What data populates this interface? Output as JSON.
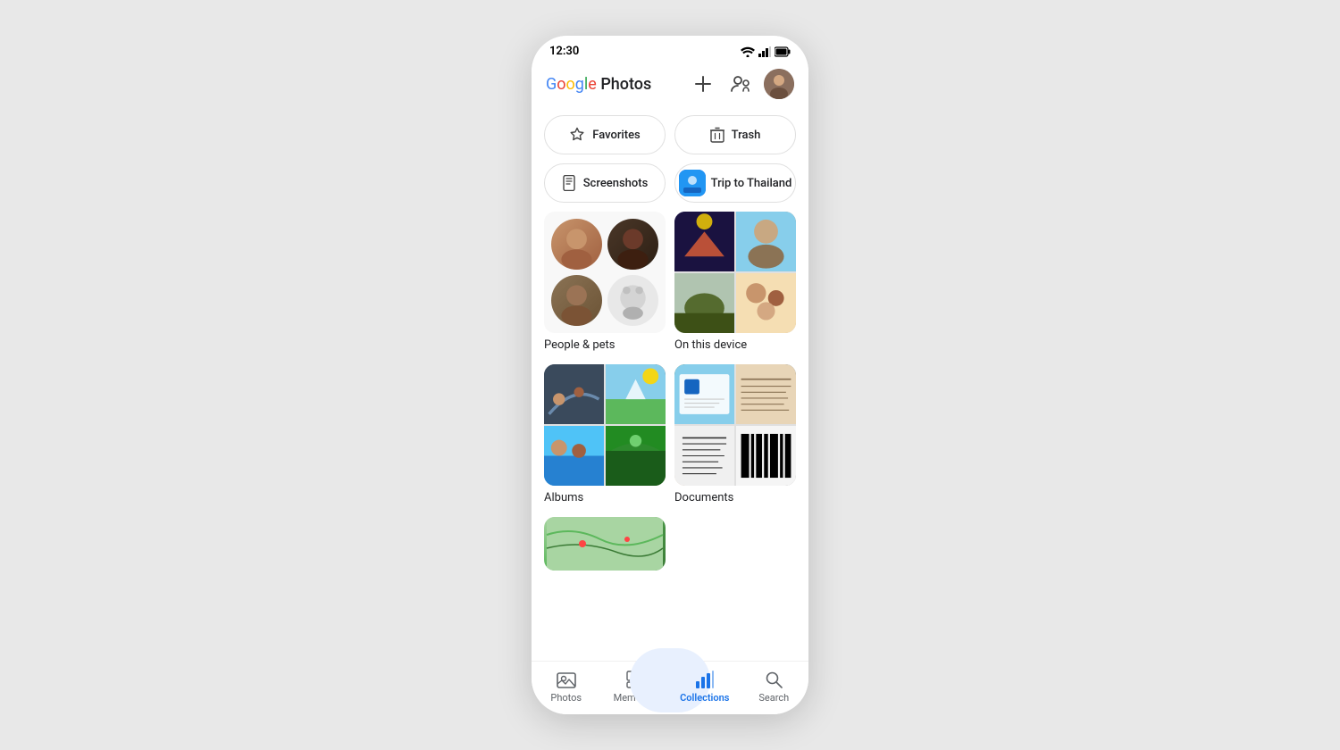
{
  "status": {
    "time": "12:30"
  },
  "header": {
    "logo_google": "Google",
    "logo_photos": "Photos",
    "add_label": "+",
    "share_label": "share",
    "avatar_alt": "user avatar"
  },
  "quick_access": {
    "favorites_label": "Favorites",
    "trash_label": "Trash",
    "screenshots_label": "Screenshots",
    "trip_label": "Trip to Thailand"
  },
  "sections": {
    "people_label": "People & pets",
    "device_label": "On this device",
    "albums_label": "Albums",
    "documents_label": "Documents"
  },
  "bottom_nav": {
    "photos_label": "Photos",
    "memories_label": "Memories",
    "collections_label": "Collections",
    "search_label": "Search"
  }
}
